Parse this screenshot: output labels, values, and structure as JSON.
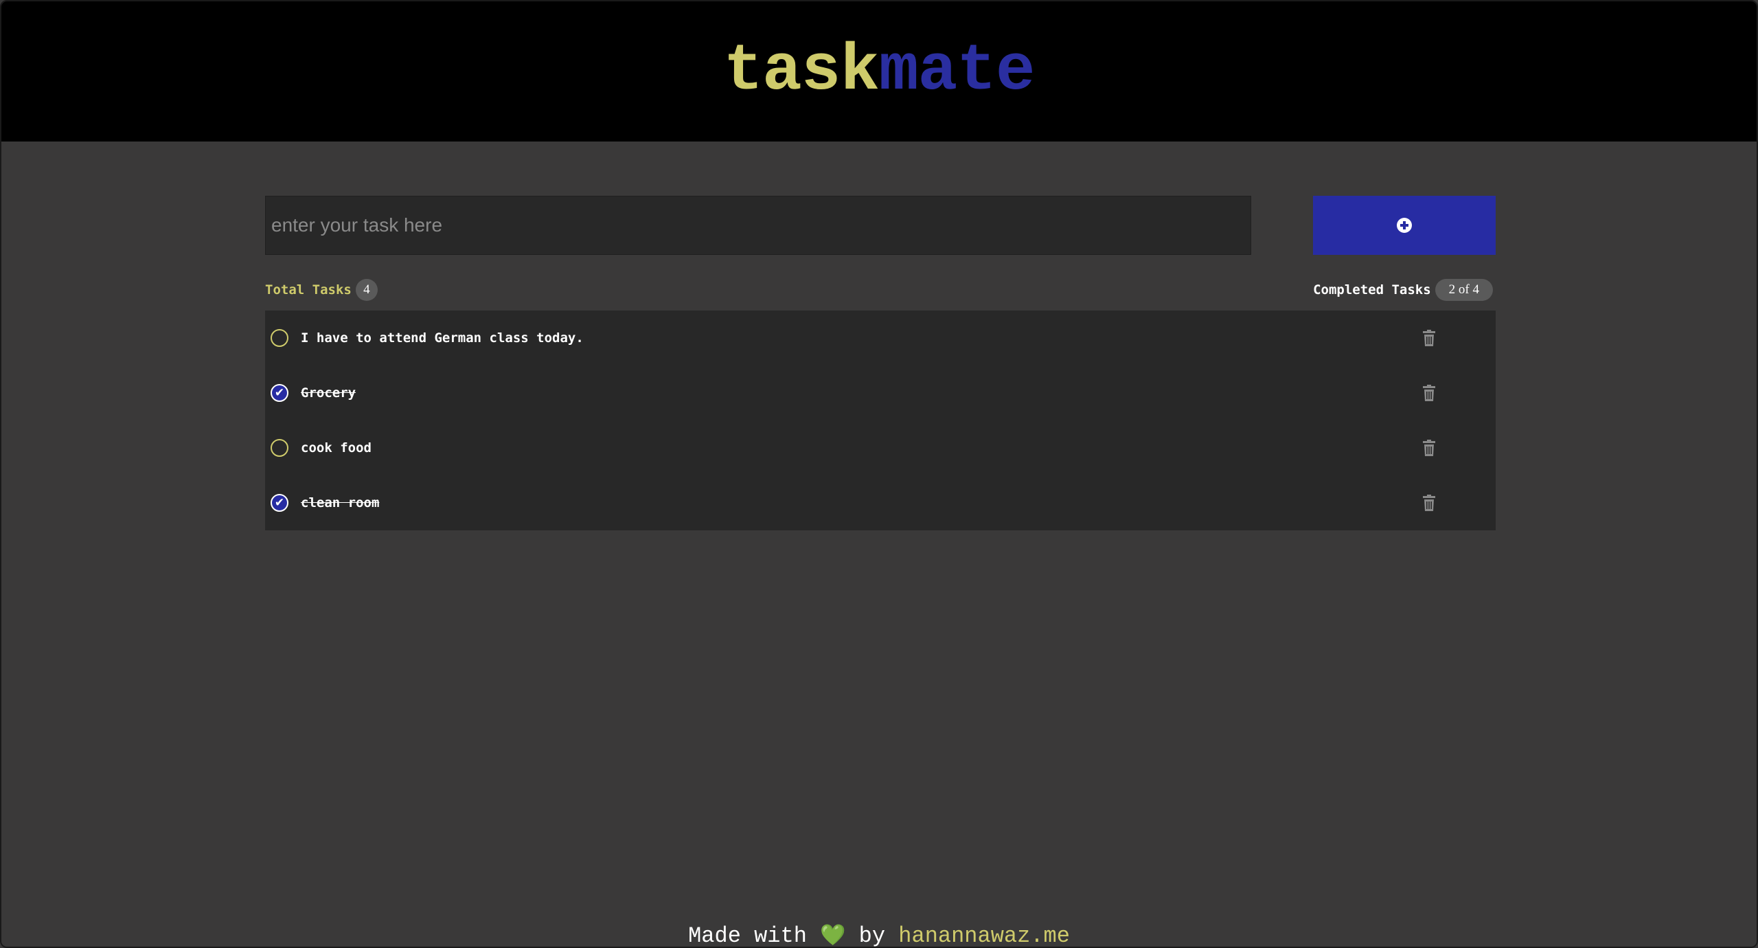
{
  "header": {
    "brand_part1": "task",
    "brand_part2": "mate"
  },
  "input": {
    "placeholder": "enter your task here",
    "value": ""
  },
  "add_button": {
    "icon": "plus-circle-icon"
  },
  "stats": {
    "total_label": "Total Tasks",
    "total_count": "4",
    "completed_label": "Completed Tasks",
    "completed_value": "2 of 4"
  },
  "tasks": [
    {
      "text": "I have to attend German class today.",
      "completed": false
    },
    {
      "text": "Grocery",
      "completed": true
    },
    {
      "text": "cook food",
      "completed": false
    },
    {
      "text": "clean room",
      "completed": true
    }
  ],
  "footer": {
    "prefix": "Made with",
    "heart": "💚",
    "by": "by",
    "link_text": "hanannawaz.me"
  },
  "colors": {
    "accent_yellow": "#cfcb6b",
    "accent_blue": "#272ca3",
    "background": "#3a3939",
    "panel": "#282828",
    "header": "#000000"
  }
}
